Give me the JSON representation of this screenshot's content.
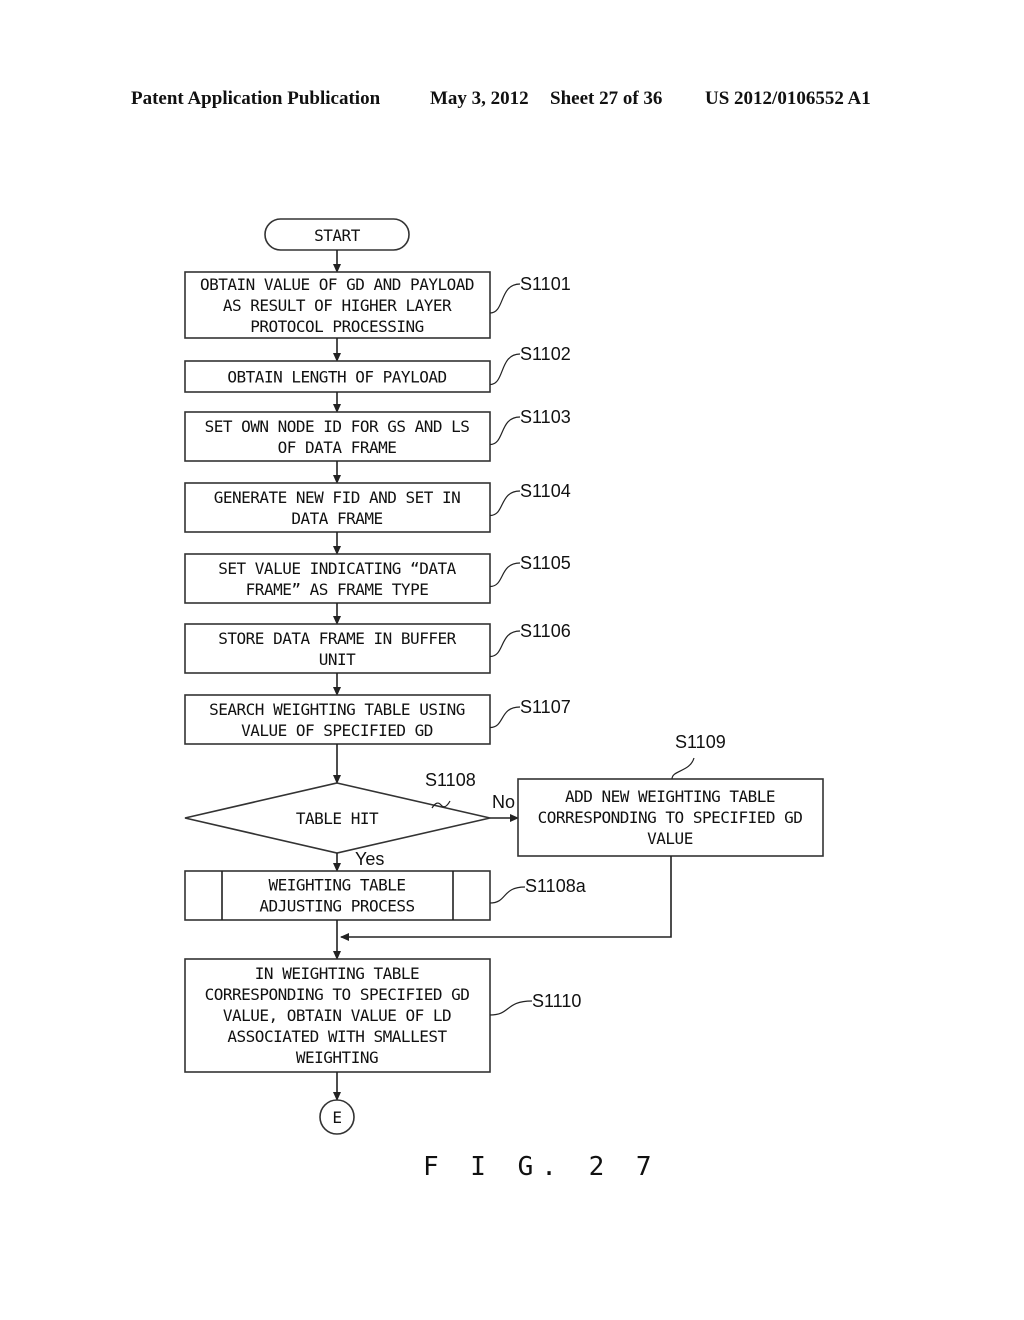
{
  "header": {
    "publication": "Patent Application Publication",
    "date": "May 3, 2012",
    "sheet": "Sheet 27 of 36",
    "number": "US 2012/0106552 A1"
  },
  "flowchart": {
    "start": "START",
    "steps": [
      {
        "id": "S1101",
        "lines": [
          "OBTAIN VALUE OF GD AND PAYLOAD",
          "AS RESULT OF HIGHER LAYER",
          "PROTOCOL PROCESSING"
        ]
      },
      {
        "id": "S1102",
        "lines": [
          "OBTAIN LENGTH OF PAYLOAD"
        ]
      },
      {
        "id": "S1103",
        "lines": [
          "SET OWN NODE ID FOR GS AND LS",
          "OF DATA FRAME"
        ]
      },
      {
        "id": "S1104",
        "lines": [
          "GENERATE NEW FID AND SET IN",
          "DATA FRAME"
        ]
      },
      {
        "id": "S1105",
        "lines": [
          "SET VALUE INDICATING “DATA",
          "FRAME” AS FRAME TYPE"
        ]
      },
      {
        "id": "S1106",
        "lines": [
          "STORE DATA FRAME IN BUFFER",
          "UNIT"
        ]
      },
      {
        "id": "S1107",
        "lines": [
          "SEARCH WEIGHTING TABLE USING",
          "VALUE OF SPECIFIED GD"
        ]
      }
    ],
    "decision": {
      "id": "S1108",
      "text": "TABLE HIT",
      "no_label": "No",
      "yes_label": "Yes"
    },
    "no_branch": {
      "id": "S1109",
      "lines": [
        "ADD NEW WEIGHTING TABLE",
        "CORRESPONDING TO SPECIFIED GD",
        "VALUE"
      ]
    },
    "subprocess": {
      "id": "S1108a",
      "lines": [
        "WEIGHTING TABLE",
        "ADJUSTING PROCESS"
      ]
    },
    "final": {
      "id": "S1110",
      "lines": [
        "IN WEIGHTING TABLE",
        "CORRESPONDING TO SPECIFIED GD",
        "VALUE, OBTAIN VALUE OF LD",
        "ASSOCIATED WITH SMALLEST",
        "WEIGHTING"
      ]
    },
    "connector": "E"
  },
  "figure_label": "F I G. 2 7"
}
